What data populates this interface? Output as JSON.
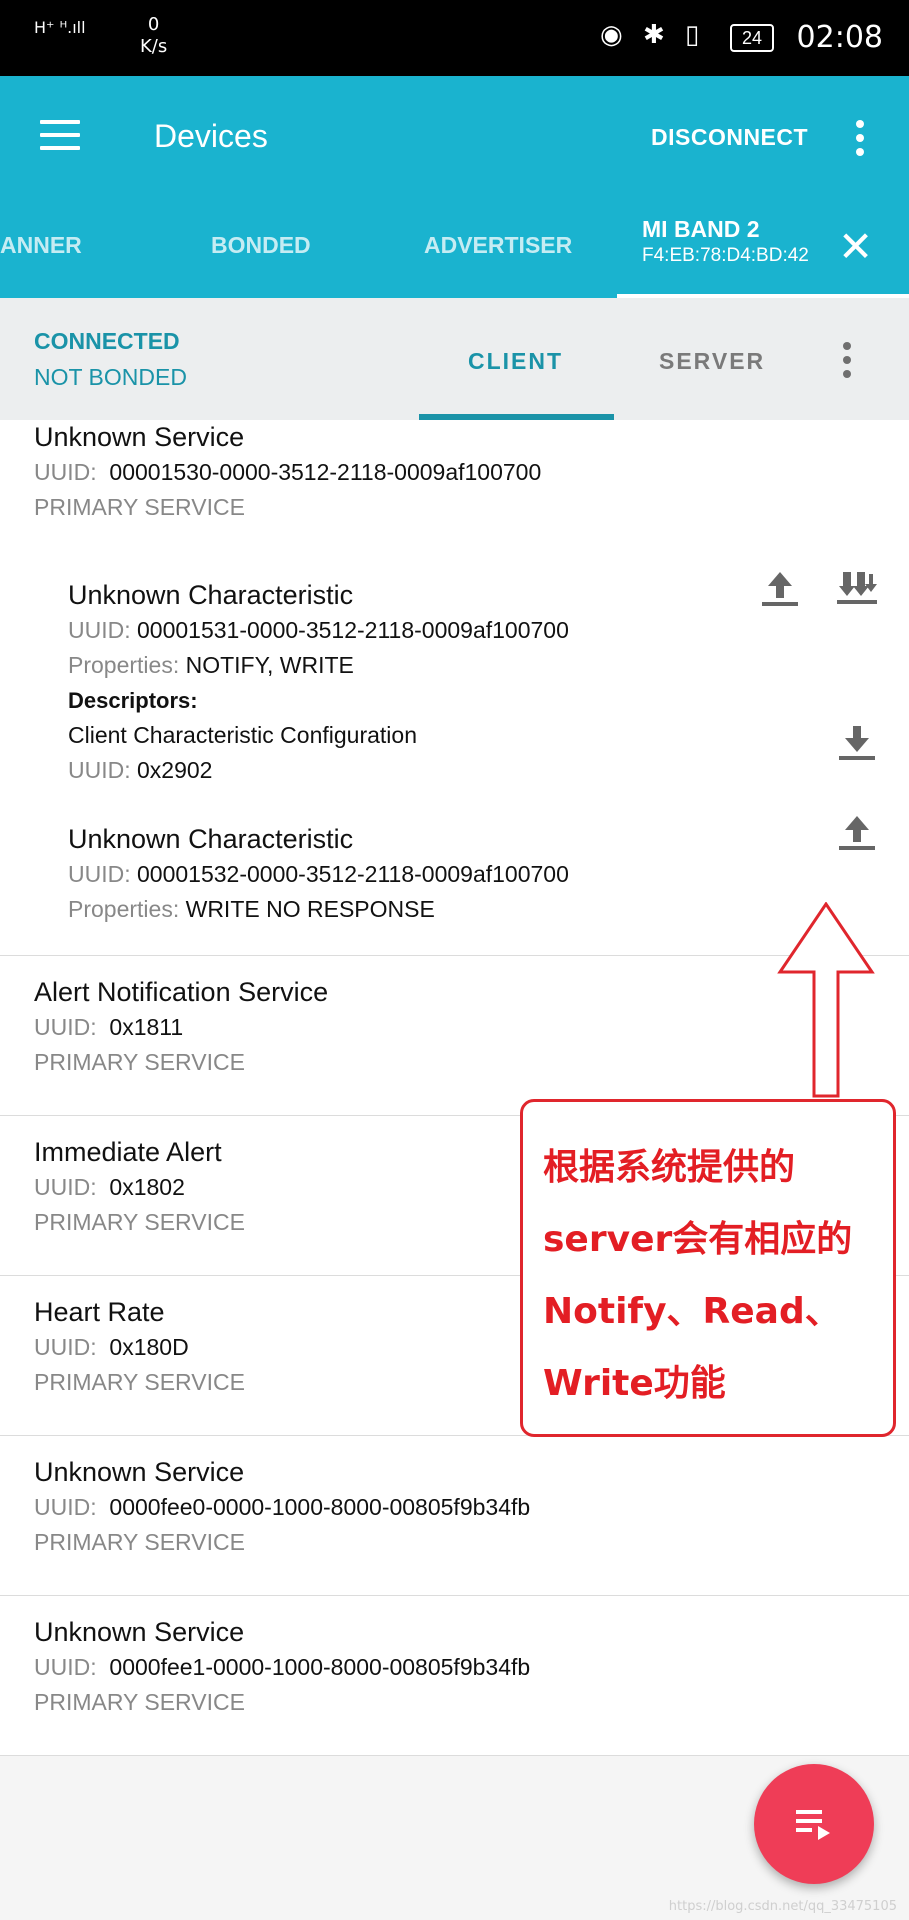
{
  "status_bar": {
    "signal": "H⁺ ᴴ.ıll",
    "speed_value": "0",
    "speed_unit": "K/s",
    "battery": "24",
    "time": "02:08"
  },
  "app_bar": {
    "title": "Devices",
    "disconnect_label": "DISCONNECT"
  },
  "tabs": [
    {
      "label": "ANNER"
    },
    {
      "label": "BONDED"
    },
    {
      "label": "ADVERTISER"
    },
    {
      "label": "MI BAND 2",
      "sub": "F4:EB:78:D4:BD:42"
    }
  ],
  "connection": {
    "state": "CONNECTED",
    "bond": "NOT BONDED",
    "client_tab": "CLIENT",
    "server_tab": "SERVER"
  },
  "uuid_label": "UUID:",
  "properties_label": "Properties:",
  "descriptors_label": "Descriptors:",
  "services": [
    {
      "name": "Unknown Service",
      "uuid": "00001530-0000-3512-2118-0009af100700",
      "type": "PRIMARY SERVICE"
    },
    {
      "name": "Alert Notification Service",
      "uuid": "0x1811",
      "type": "PRIMARY SERVICE"
    },
    {
      "name": "Immediate Alert",
      "uuid": "0x1802",
      "type": "PRIMARY SERVICE"
    },
    {
      "name": "Heart Rate",
      "uuid": "0x180D",
      "type": "PRIMARY SERVICE"
    },
    {
      "name": "Unknown Service",
      "uuid": "0000fee0-0000-1000-8000-00805f9b34fb",
      "type": "PRIMARY SERVICE"
    },
    {
      "name": "Unknown Service",
      "uuid": "0000fee1-0000-1000-8000-00805f9b34fb",
      "type": "PRIMARY SERVICE"
    }
  ],
  "characteristics": [
    {
      "name": "Unknown Characteristic",
      "uuid": "00001531-0000-3512-2118-0009af100700",
      "properties": "NOTIFY, WRITE",
      "descriptor": {
        "name": "Client Characteristic Configuration",
        "uuid": "0x2902"
      }
    },
    {
      "name": "Unknown Characteristic",
      "uuid": "00001532-0000-3512-2118-0009af100700",
      "properties": "WRITE NO RESPONSE"
    }
  ],
  "annotation": {
    "line1": "根据系统提供的",
    "line2": "server会有相应的",
    "line3": "Notify、Read、",
    "line4": "Write功能"
  },
  "watermark": "https://blog.csdn.net/qq_33475105",
  "colors": {
    "app_bar": "#1ab3cf",
    "accent": "#1a93a8",
    "annotation": "#e31e24",
    "fab": "#ef3d57"
  }
}
